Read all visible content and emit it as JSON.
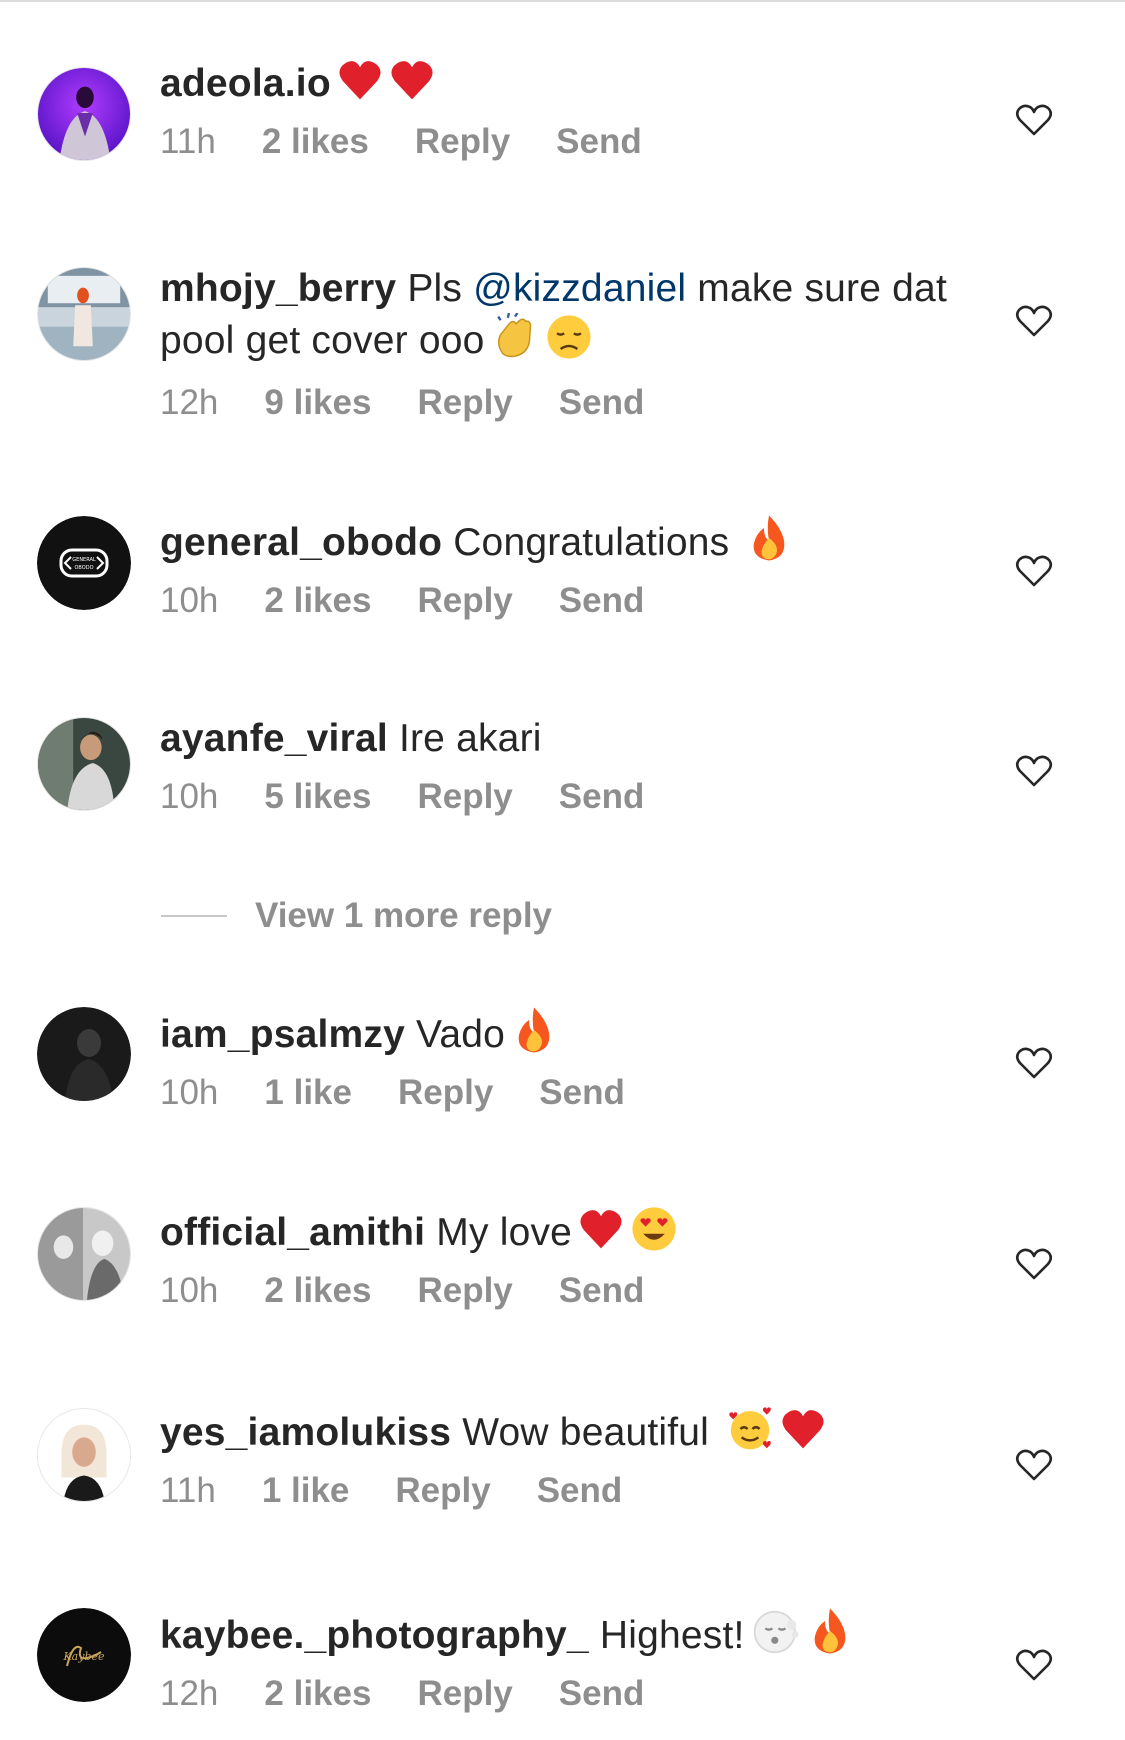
{
  "comments": [
    {
      "username": "adeola.io",
      "text": "",
      "emojis": [
        "heart",
        "heart"
      ],
      "time": "11h",
      "likes": "2 likes",
      "reply": "Reply",
      "send": "Send",
      "avatar": "purple-photo"
    },
    {
      "username": "mhojy_berry",
      "text_pre": "Pls ",
      "mention": "@kizzdaniel",
      "text_post": "  make sure dat pool get cover ooo",
      "emojis": [
        "clap",
        "disappointed"
      ],
      "time": "12h",
      "likes": "9 likes",
      "reply": "Reply",
      "send": "Send",
      "avatar": "pool-photo"
    },
    {
      "username": "general_obodo",
      "text": "Congratulations ",
      "emojis": [
        "fire"
      ],
      "time": "10h",
      "likes": "2 likes",
      "reply": "Reply",
      "send": "Send",
      "avatar": "logo-g"
    },
    {
      "username": "ayanfe_viral",
      "text": "Ire akari",
      "emojis": [],
      "time": "10h",
      "likes": "5 likes",
      "reply": "Reply",
      "send": "Send",
      "avatar": "person-photo"
    },
    {
      "username": "iam_psalmzy",
      "text": "Vado",
      "emojis": [
        "fire"
      ],
      "time": "10h",
      "likes": "1 like",
      "reply": "Reply",
      "send": "Send",
      "avatar": "dark-photo"
    },
    {
      "username": "official_amithi",
      "text": "My love",
      "emojis": [
        "heart",
        "heart-eyes"
      ],
      "time": "10h",
      "likes": "2 likes",
      "reply": "Reply",
      "send": "Send",
      "avatar": "grey-photo"
    },
    {
      "username": "yes_iamolukiss",
      "text": "Wow beautiful ",
      "emojis": [
        "smiling-hearts",
        "heart"
      ],
      "time": "11h",
      "likes": "1 like",
      "reply": "Reply",
      "send": "Send",
      "avatar": "blonde-photo"
    },
    {
      "username": "kaybee._photography_",
      "text": "Highest!",
      "emojis": [
        "face-exhale",
        "fire"
      ],
      "time": "12h",
      "likes": "2 likes",
      "reply": "Reply",
      "send": "Send",
      "avatar": "signature-logo"
    }
  ],
  "more_replies_label": "View 1 more reply",
  "colors": {
    "text": "#262626",
    "meta": "#8e8e8e",
    "mention": "#00376b",
    "heart": "#e0212b"
  },
  "icons": {
    "like": "heart-outline-icon"
  }
}
